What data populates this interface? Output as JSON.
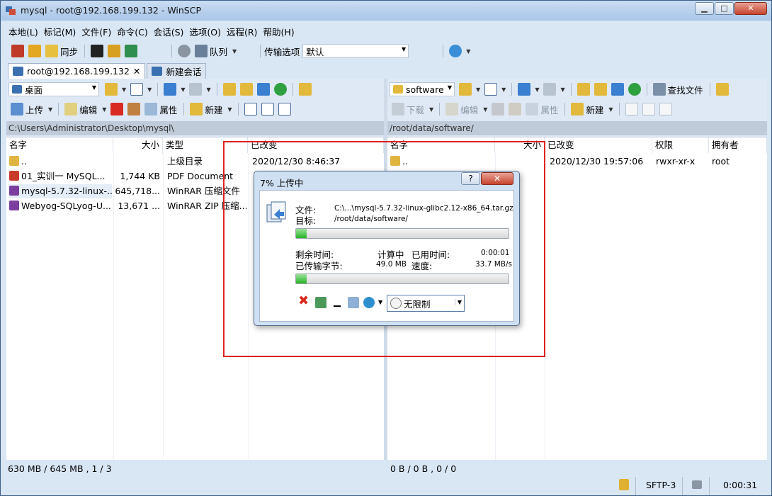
{
  "window": {
    "title": "mysql - root@192.168.199.132 - WinSCP",
    "min_label": "▁",
    "max_label": "□",
    "close_label": "✕"
  },
  "menu": [
    "本地(L)",
    "标记(M)",
    "文件(F)",
    "命令(C)",
    "会话(S)",
    "选项(O)",
    "远程(R)",
    "帮助(H)"
  ],
  "toolbar": {
    "sync_label": "同步",
    "queue_label": "队列",
    "transfer_label": "传输选项",
    "transfer_value": "默认"
  },
  "tabs": [
    {
      "label": "root@192.168.199.132",
      "close": "✕"
    },
    {
      "label": "新建会话"
    }
  ],
  "left": {
    "location": "桌面",
    "upload_label": "上传",
    "edit_label": "编辑",
    "properties_label": "属性",
    "new_label": "新建",
    "path": "C:\\Users\\Administrator\\Desktop\\mysql\\",
    "columns": [
      "名字",
      "大小",
      "类型",
      "已改变"
    ],
    "files": [
      {
        "name": "..",
        "size": "",
        "type": "上级目录",
        "changed": "2020/12/30  8:46:37",
        "icon_color": "#e0b440"
      },
      {
        "name": "01_实训一  MySQL...",
        "size": "1,744 KB",
        "type": "PDF Document",
        "changed": "",
        "icon_color": "#c83a2a"
      },
      {
        "name": "mysql-5.7.32-linux-...",
        "size": "645,718...",
        "type": "WinRAR 压缩文件",
        "changed": "",
        "icon_color": "#7a3f9e"
      },
      {
        "name": "Webyog-SQLyog-U...",
        "size": "13,671 ...",
        "type": "WinRAR ZIP 压缩...",
        "changed": "",
        "icon_color": "#7a3f9e"
      }
    ],
    "status": "630 MB / 645 MB ,  1 / 3"
  },
  "right": {
    "location": "software",
    "download_label": "下载",
    "edit_label": "编辑",
    "properties_label": "属性",
    "new_label": "新建",
    "find_label": "查找文件",
    "path": "/root/data/software/",
    "columns": [
      "名字",
      "大小",
      "已改变",
      "权限",
      "拥有者"
    ],
    "files": [
      {
        "name": "..",
        "size": "",
        "changed": "2020/12/30 19:57:06",
        "rights": "rwxr-xr-x",
        "owner": "root",
        "icon_color": "#e0b440"
      }
    ],
    "status": "0 B / 0 B ,  0 / 0"
  },
  "bottom": {
    "protocol": "SFTP-3",
    "elapsed": "0:00:31"
  },
  "dialog": {
    "title": "7% 上传中",
    "help_label": "?",
    "close_label": "✕",
    "file_label": "文件:",
    "file_value": "C:\\...\\mysql-5.7.32-linux-glibc2.12-x86_64.tar.gz",
    "target_label": "目标:",
    "target_value": "/root/data/software/",
    "file_progress": 0.05,
    "remaining_label": "剩余时间:",
    "remaining_value": "计算中",
    "elapsed_label": "已用时间:",
    "elapsed_value": "0:00:01",
    "transferred_label": "已传输字节:",
    "transferred_value": "49.0 MB",
    "speed_label": "速度:",
    "speed_value": "33.7 MB/s",
    "total_progress": 0.05,
    "speed_limit": "无限制"
  },
  "colors": {
    "highlight_box": "#dd2222",
    "progress_fill": "#28b228",
    "path_bar": "#bfcbd9"
  }
}
